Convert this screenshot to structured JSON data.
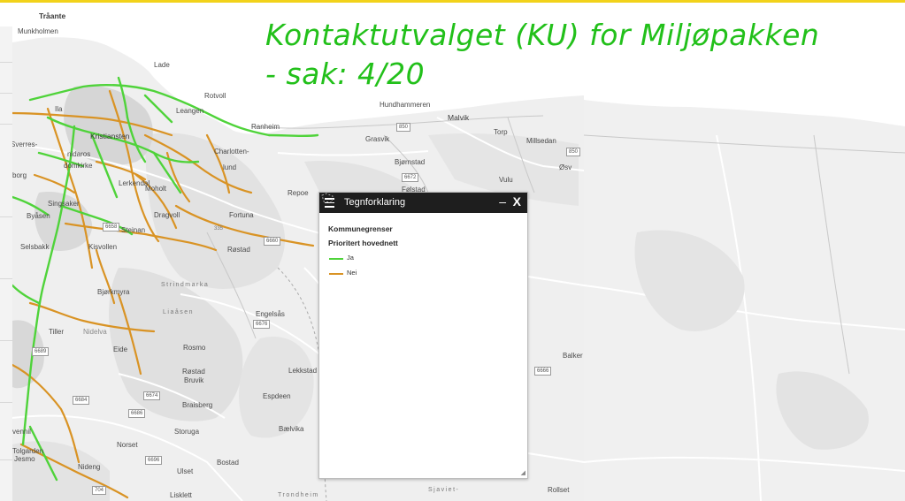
{
  "slide": {
    "title": "Kontaktutvalget (KU) for Miljøpakken\n- sak: 4/20",
    "title_color": "#22c01a",
    "accent_rule_color": "#f2d21a"
  },
  "map": {
    "labels": [
      {
        "id": "traante",
        "text": "Tråante",
        "cls": "town",
        "bold": true
      },
      {
        "id": "munkholmen",
        "text": "Munkholmen",
        "cls": ""
      },
      {
        "id": "lade",
        "text": "Lade",
        "cls": ""
      },
      {
        "id": "rotvoll",
        "text": "Rotvoll",
        "cls": ""
      },
      {
        "id": "ila",
        "text": "Ila",
        "cls": ""
      },
      {
        "id": "leangen",
        "text": "Leangen",
        "cls": ""
      },
      {
        "id": "ranheim",
        "text": "Ranheim",
        "cls": ""
      },
      {
        "id": "kristiansten",
        "text": "Kristiansten",
        "cls": "town"
      },
      {
        "id": "charlotten",
        "text": "Charlotten-",
        "cls": ""
      },
      {
        "id": "lund",
        "text": "lund",
        "cls": ""
      },
      {
        "id": "svartlamoen",
        "text": "Sverres-",
        "cls": ""
      },
      {
        "id": "borg",
        "text": "borg",
        "cls": ""
      },
      {
        "id": "nidaros",
        "text": "nidaros",
        "cls": ""
      },
      {
        "id": "domkirke",
        "text": "domkirke",
        "cls": ""
      },
      {
        "id": "byasen",
        "text": "Byåsen",
        "cls": ""
      },
      {
        "id": "singsaker",
        "text": "Singsaker",
        "cls": ""
      },
      {
        "id": "lerkendal",
        "text": "Lerkendal",
        "cls": ""
      },
      {
        "id": "moholt",
        "text": "Moholt",
        "cls": ""
      },
      {
        "id": "dragvoll",
        "text": "Dragvoll",
        "cls": ""
      },
      {
        "id": "fortuna",
        "text": "Fortuna",
        "cls": ""
      },
      {
        "id": "rostad",
        "text": "Røstad",
        "cls": ""
      },
      {
        "id": "selsbakk",
        "text": "Selsbakk",
        "cls": ""
      },
      {
        "id": "steinan",
        "text": "Steinan",
        "cls": ""
      },
      {
        "id": "kisvollen",
        "text": "Kisvollen",
        "cls": ""
      },
      {
        "id": "bjorkmyra",
        "text": "Bjørkmyra",
        "cls": ""
      },
      {
        "id": "strindmarka",
        "text": "Strindmarka",
        "cls": "area"
      },
      {
        "id": "lianon",
        "text": "Liaåsen",
        "cls": "area"
      },
      {
        "id": "engelsas",
        "text": "Engelsås",
        "cls": ""
      },
      {
        "id": "tiller",
        "text": "Tiller",
        "cls": ""
      },
      {
        "id": "nidelva",
        "text": "Nidelva",
        "cls": ""
      },
      {
        "id": "eide",
        "text": "Eide",
        "cls": ""
      },
      {
        "id": "rosmo",
        "text": "Rosmo",
        "cls": ""
      },
      {
        "id": "rostadbruk",
        "text": "Røstad",
        "cls": ""
      },
      {
        "id": "bruvik",
        "text": "Bruvik",
        "cls": ""
      },
      {
        "id": "lekkstad",
        "text": "Lekkstad",
        "cls": ""
      },
      {
        "id": "espdeen",
        "text": "Espdeen",
        "cls": ""
      },
      {
        "id": "braisberg",
        "text": "Braisberg",
        "cls": ""
      },
      {
        "id": "storuga",
        "text": "Storuga",
        "cls": ""
      },
      {
        "id": "bjelvika",
        "text": "Bælvika",
        "cls": ""
      },
      {
        "id": "vennil",
        "text": "vennil",
        "cls": ""
      },
      {
        "id": "norset",
        "text": "Norset",
        "cls": ""
      },
      {
        "id": "fjolgarden",
        "text": "Tolgarden",
        "cls": ""
      },
      {
        "id": "jesmo",
        "text": "Jesmo",
        "cls": ""
      },
      {
        "id": "nideng",
        "text": "Nideng",
        "cls": ""
      },
      {
        "id": "ulset",
        "text": "Ulset",
        "cls": ""
      },
      {
        "id": "bostad",
        "text": "Bostad",
        "cls": ""
      },
      {
        "id": "lisklett",
        "text": "Lisklett",
        "cls": ""
      },
      {
        "id": "trondheim",
        "text": "Trondheim",
        "cls": "area"
      },
      {
        "id": "sjaviet",
        "text": "Sjaviet-",
        "cls": "area"
      },
      {
        "id": "hundhammeren",
        "text": "Hundhammeren",
        "cls": ""
      },
      {
        "id": "malvik",
        "text": "Malvik",
        "cls": "town"
      },
      {
        "id": "torp",
        "text": "Torp",
        "cls": ""
      },
      {
        "id": "millesedan",
        "text": "Millsedan",
        "cls": ""
      },
      {
        "id": "grasvik",
        "text": "Grasvik",
        "cls": ""
      },
      {
        "id": "bjarnstad",
        "text": "Bjørnstad",
        "cls": ""
      },
      {
        "id": "vuo",
        "text": "Vulu",
        "cls": ""
      },
      {
        "id": "felstad",
        "text": "Følstad",
        "cls": ""
      },
      {
        "id": "repoe",
        "text": "Repoe",
        "cls": ""
      },
      {
        "id": "baikes",
        "text": "Balker",
        "cls": ""
      },
      {
        "id": "rollset",
        "text": "Rollset",
        "cls": ""
      },
      {
        "id": "ebanu",
        "text": "Øsv",
        "cls": ""
      }
    ],
    "shields": [
      {
        "id": "s850a",
        "text": "850"
      },
      {
        "id": "s850b",
        "text": "850"
      },
      {
        "id": "s6672",
        "text": "6672"
      },
      {
        "id": "s6658",
        "text": "6658"
      },
      {
        "id": "s6660",
        "text": "6660"
      },
      {
        "id": "s6676",
        "text": "6676"
      },
      {
        "id": "s6674",
        "text": "6674"
      },
      {
        "id": "s6684",
        "text": "6684"
      },
      {
        "id": "s6686",
        "text": "6686"
      },
      {
        "id": "s6696",
        "text": "6696"
      },
      {
        "id": "s704",
        "text": "704"
      },
      {
        "id": "s335",
        "text": "335"
      },
      {
        "id": "s6666",
        "text": "6666"
      },
      {
        "id": "s6689",
        "text": "6689"
      }
    ],
    "road_colors": {
      "prioritized": "#4fd33a",
      "other": "#d99324"
    }
  },
  "legend": {
    "header_title": "Tegnforklaring",
    "minimize_label": "–",
    "close_label": "X",
    "section_boundaries": "Kommunegrenser",
    "section_network": "Prioritert hovednett",
    "items": [
      {
        "label": "Ja",
        "color": "#4fd33a"
      },
      {
        "label": "Nei",
        "color": "#d99324"
      }
    ]
  }
}
